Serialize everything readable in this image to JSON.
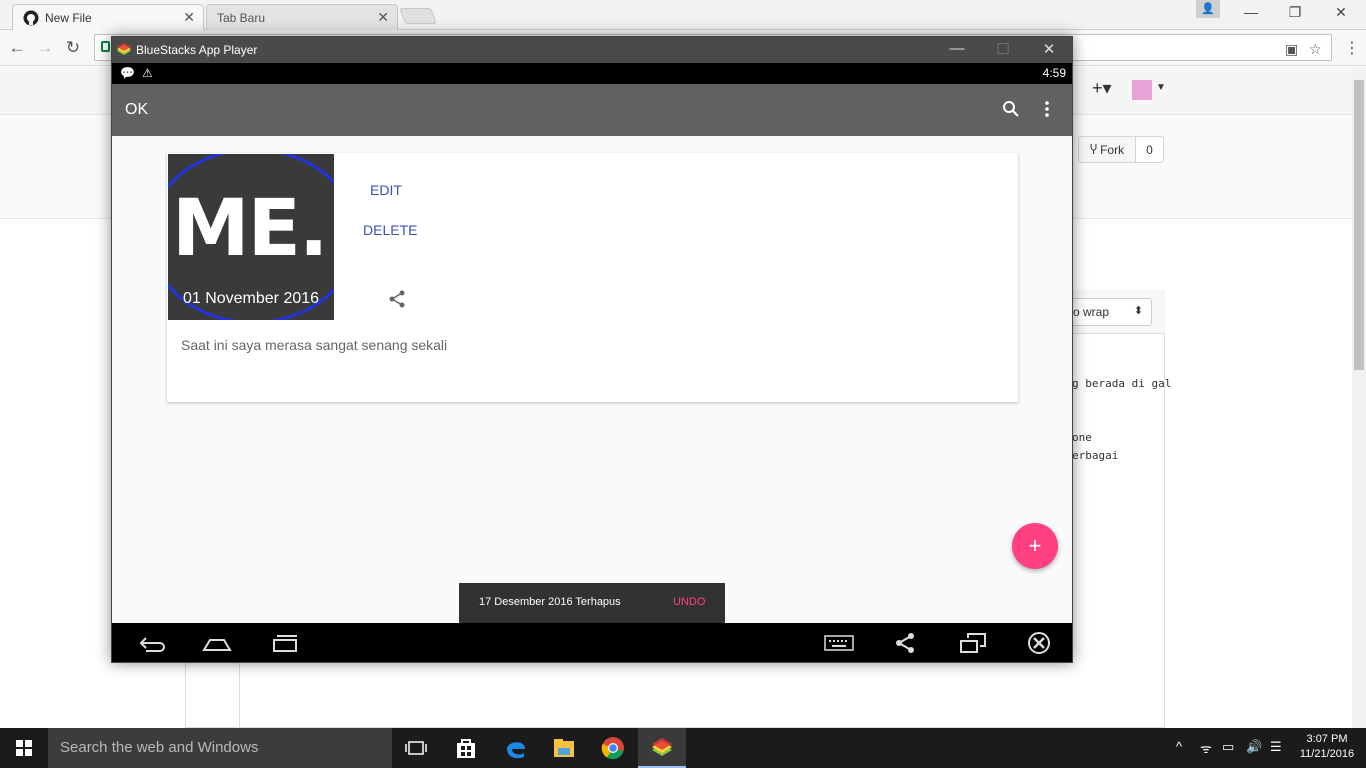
{
  "browser": {
    "tabs": [
      {
        "label": "New File",
        "active": true,
        "icon": "github-icon"
      },
      {
        "label": "Tab Baru",
        "active": false
      }
    ]
  },
  "github": {
    "fork_label": "Fork",
    "fork_count": "0",
    "wrap_select": "o wrap",
    "code_lines": [
      "g berada di gal",
      "one",
      "erbagai"
    ]
  },
  "bluestacks": {
    "window_title": "BlueStacks App Player",
    "status_time": "4:59",
    "app_title": "OK",
    "card": {
      "image_text": "ME.",
      "image_date": "01 November 2016",
      "edit_label": "EDIT",
      "delete_label": "DELETE",
      "body_text": "Saat ini saya merasa sangat senang sekali"
    },
    "fab_label": "+",
    "snackbar": {
      "message": "17 Desember 2016 Terhapus",
      "action": "UNDO"
    }
  },
  "taskbar": {
    "search_placeholder": "Search the web and Windows",
    "time": "3:07 PM",
    "date": "11/21/2016"
  },
  "colors": {
    "accent_pink": "#ff4081",
    "indigo": "#3f51b5",
    "appbar": "#616161"
  }
}
